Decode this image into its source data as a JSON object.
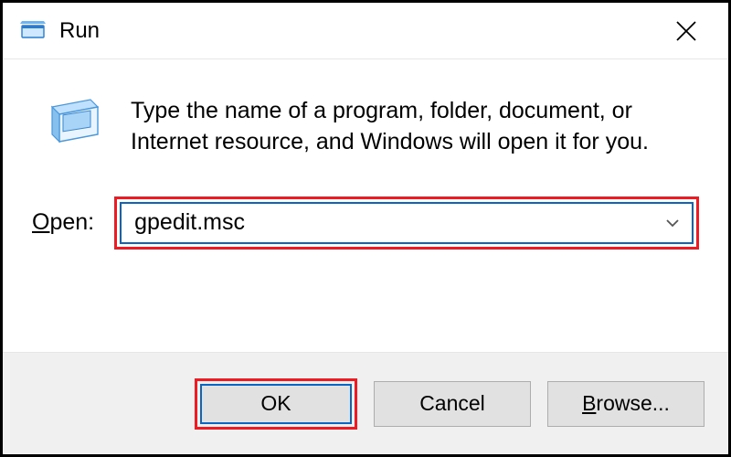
{
  "title": "Run",
  "close_label": "Close",
  "description": "Type the name of a program, folder, document, or Internet resource, and Windows will open it for you.",
  "open_label_pre": "O",
  "open_label_post": "pen:",
  "input_value": "gpedit.msc",
  "buttons": {
    "ok": "OK",
    "cancel": "Cancel",
    "browse_pre": "B",
    "browse_post": "rowse..."
  },
  "colors": {
    "highlight_red": "#ed1c24",
    "selection_blue": "#0a66c2"
  }
}
